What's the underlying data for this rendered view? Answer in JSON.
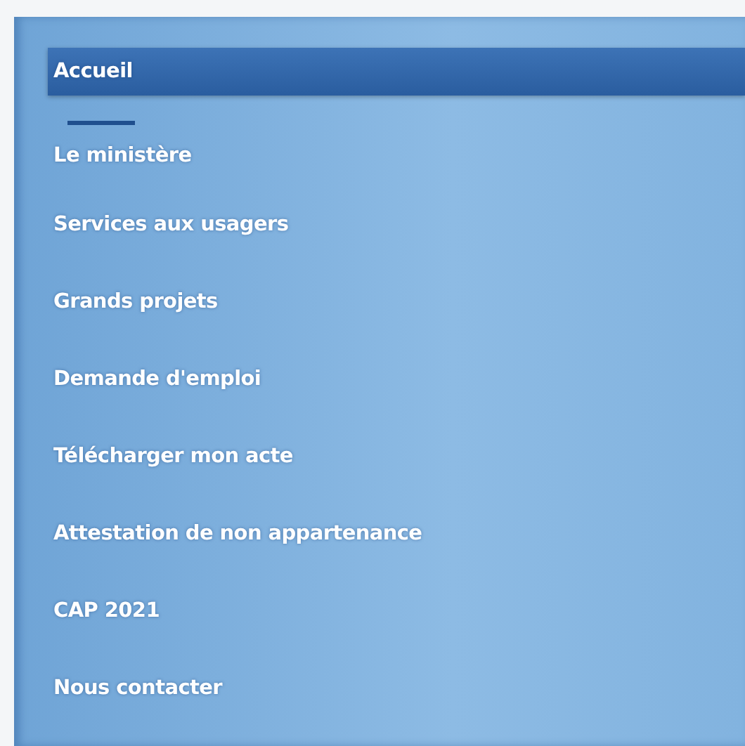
{
  "menu": {
    "items": [
      {
        "label": "Accueil",
        "selected": true
      },
      {
        "label": "Le ministère",
        "selected": false
      },
      {
        "label": "Services aux usagers",
        "selected": false
      },
      {
        "label": "Grands projets",
        "selected": false
      },
      {
        "label": "Demande d'emploi",
        "selected": false
      },
      {
        "label": "Télécharger mon acte",
        "selected": false
      },
      {
        "label": "Attestation de non appartenance",
        "selected": false
      },
      {
        "label": "CAP 2021",
        "selected": false
      },
      {
        "label": "Nous contacter",
        "selected": false
      }
    ]
  }
}
